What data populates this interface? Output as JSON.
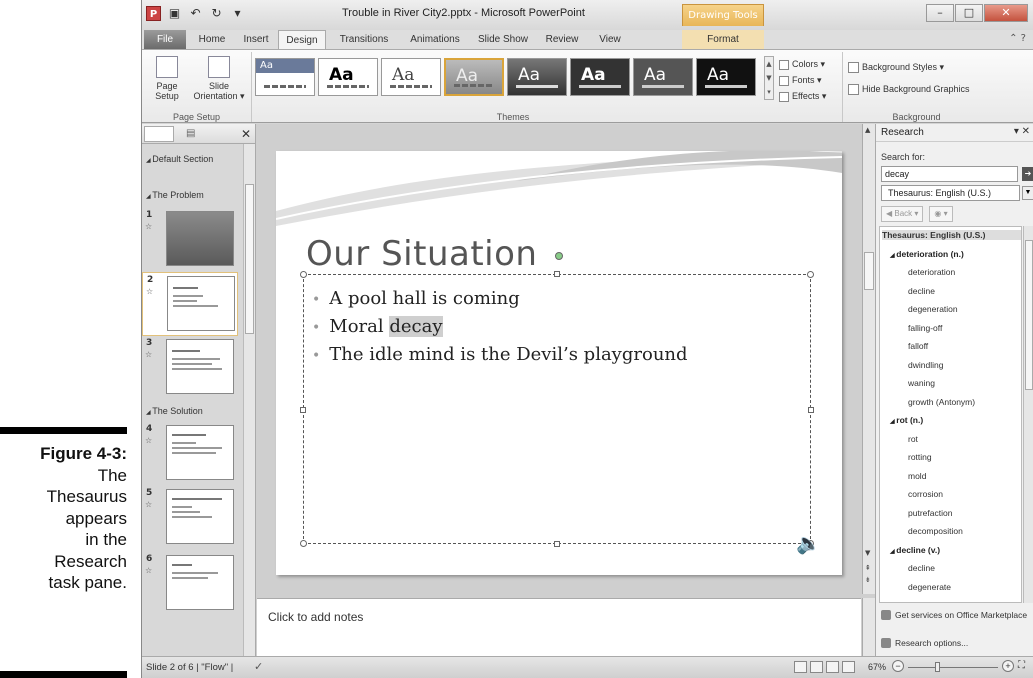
{
  "figure": {
    "number": "Figure 4-3:",
    "caption": [
      "The",
      "Thesaurus",
      "appears",
      "in the",
      "Research",
      "task pane."
    ]
  },
  "window": {
    "title": "Trouble in River City2.pptx - Microsoft PowerPoint",
    "context_tab_group": "Drawing Tools"
  },
  "tabs": [
    {
      "label": "File"
    },
    {
      "label": "Home"
    },
    {
      "label": "Insert"
    },
    {
      "label": "Design"
    },
    {
      "label": "Transitions"
    },
    {
      "label": "Animations"
    },
    {
      "label": "Slide Show"
    },
    {
      "label": "Review"
    },
    {
      "label": "View"
    },
    {
      "label": "Format"
    }
  ],
  "ribbon": {
    "page_setup": {
      "setup_label": "Page Setup",
      "orientation_label": "Slide Orientation",
      "group_label": "Page Setup"
    },
    "themes": {
      "thumb_text": [
        "Aa",
        "Aa",
        "Aa",
        "Aa",
        "Aa",
        "Aa",
        "Aa",
        "Aa"
      ],
      "group_label": "Themes"
    },
    "theme_options": {
      "colors": "Colors",
      "fonts": "Fonts",
      "effects": "Effects"
    },
    "background": {
      "styles": "Background Styles",
      "hide": "Hide Background Graphics",
      "group_label": "Background"
    }
  },
  "slide_pane": {
    "sections": [
      "Default Section",
      "The Problem",
      "The Solution"
    ],
    "slides": [
      "1",
      "2",
      "3",
      "4",
      "5",
      "6"
    ],
    "selected": 2
  },
  "slide": {
    "title": "Our Situation",
    "bullets": [
      {
        "pre": "A pool hall is coming",
        "hl": "",
        "post": ""
      },
      {
        "pre": "Moral ",
        "hl": "decay",
        "post": ""
      },
      {
        "pre": "The idle mind is the Devil’s playground",
        "hl": "",
        "post": ""
      }
    ]
  },
  "notes": {
    "placeholder": "Click to add notes"
  },
  "research": {
    "title": "Research",
    "search_label": "Search for:",
    "query": "decay",
    "source": "Thesaurus: English (U.S.)",
    "back_label": "Back",
    "results": [
      {
        "text": "Thesaurus: English (U.S.)",
        "kind": "dict"
      },
      {
        "text": "deterioration (n.)",
        "kind": "head"
      },
      {
        "text": "deterioration",
        "kind": "item"
      },
      {
        "text": "decline",
        "kind": "item"
      },
      {
        "text": "degeneration",
        "kind": "item"
      },
      {
        "text": "falling-off",
        "kind": "item"
      },
      {
        "text": "falloff",
        "kind": "item"
      },
      {
        "text": "dwindling",
        "kind": "item"
      },
      {
        "text": "waning",
        "kind": "item"
      },
      {
        "text": "growth (Antonym)",
        "kind": "item"
      },
      {
        "text": "rot (n.)",
        "kind": "head"
      },
      {
        "text": "rot",
        "kind": "item"
      },
      {
        "text": "rotting",
        "kind": "item"
      },
      {
        "text": "mold",
        "kind": "item"
      },
      {
        "text": "corrosion",
        "kind": "item"
      },
      {
        "text": "putrefaction",
        "kind": "item"
      },
      {
        "text": "decomposition",
        "kind": "item"
      },
      {
        "text": "decline (v.)",
        "kind": "head"
      },
      {
        "text": "decline",
        "kind": "item"
      },
      {
        "text": "degenerate",
        "kind": "item"
      }
    ],
    "footer": [
      "Get services on Office Marketplace",
      "Research options..."
    ]
  },
  "status": {
    "text": "Slide 2 of 6  |  \"Flow\"  |",
    "zoom": "67%",
    "zoom_fraction": 0.67
  },
  "colors": {
    "accent": "#e8b658",
    "file_tab": "#6b6b6b"
  }
}
